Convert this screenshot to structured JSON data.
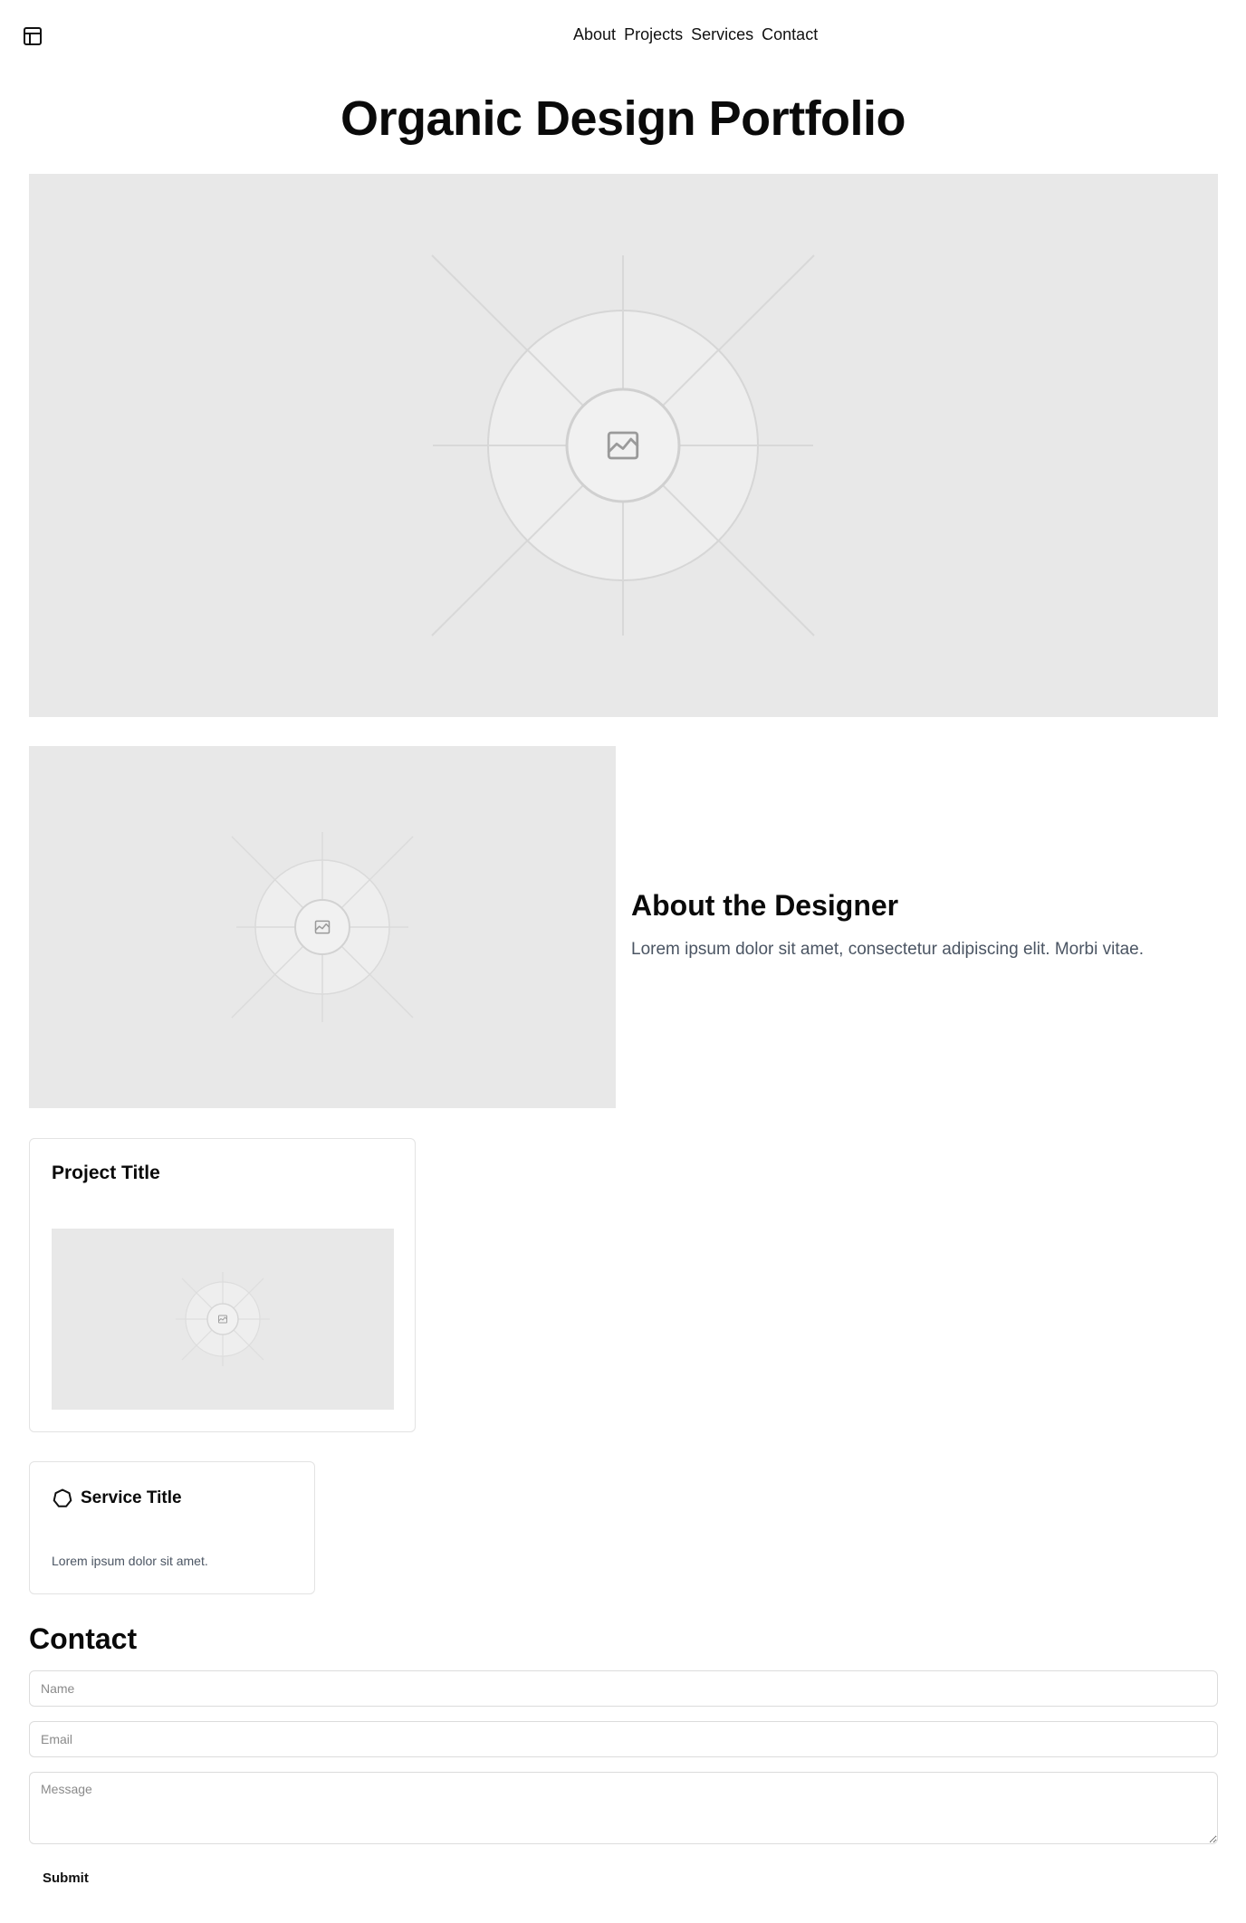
{
  "header": {
    "menu_icon": "layout-panel-icon",
    "nav": [
      "About",
      "Projects",
      "Services",
      "Contact"
    ]
  },
  "page_title": "Organic Design Portfolio",
  "hero": {
    "image_icon": "image-icon"
  },
  "about": {
    "heading": "About the Designer",
    "text": "Lorem ipsum dolor sit amet, consectetur adipiscing elit. Morbi vitae.",
    "image_icon": "image-icon"
  },
  "project": {
    "title": "Project Title",
    "image_icon": "image-icon"
  },
  "service": {
    "icon": "heptagon-icon",
    "title": "Service Title",
    "description": "Lorem ipsum dolor sit amet."
  },
  "contact": {
    "heading": "Contact",
    "name_placeholder": "Name",
    "email_placeholder": "Email",
    "message_placeholder": "Message",
    "submit_label": "Submit"
  },
  "colors": {
    "placeholder_bg": "#e8e8e8",
    "body_text_muted": "#4b5563",
    "border": "#e3e3e3"
  }
}
